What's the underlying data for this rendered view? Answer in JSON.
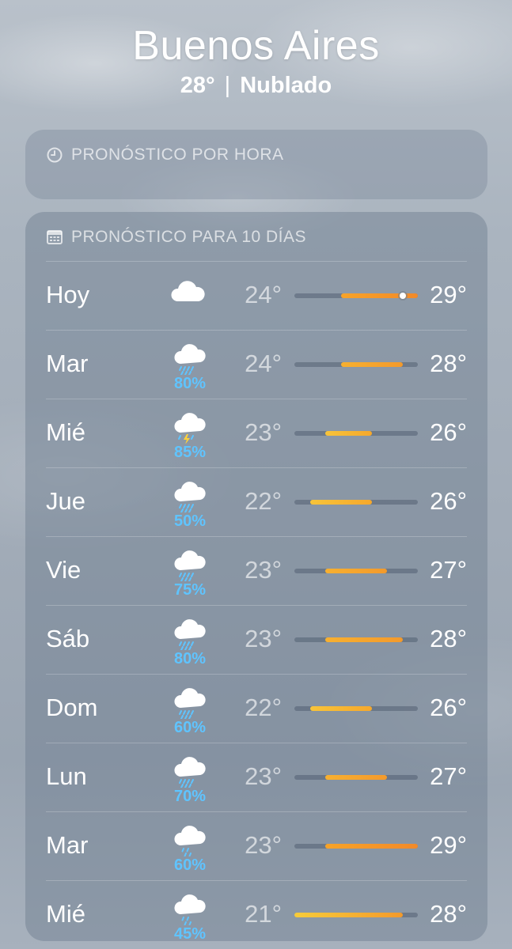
{
  "location": {
    "city": "Buenos Aires",
    "temp": "28°",
    "separator": "|",
    "condition": "Nublado"
  },
  "hourly": {
    "title": "PRONÓSTICO POR HORA",
    "icon": "clock-icon"
  },
  "daily": {
    "title": "PRONÓSTICO PARA 10 DÍAS",
    "icon": "calendar-icon",
    "range": {
      "min": 21,
      "max": 29
    },
    "days": [
      {
        "day": "Hoy",
        "icon": "cloud-icon",
        "precip": "",
        "low": "24°",
        "high": "29°",
        "low_val": 24,
        "high_val": 29,
        "current_val": 28
      },
      {
        "day": "Mar",
        "icon": "cloud-rain-icon",
        "precip": "80%",
        "low": "24°",
        "high": "28°",
        "low_val": 24,
        "high_val": 28
      },
      {
        "day": "Mié",
        "icon": "cloud-bolt-rain-icon",
        "precip": "85%",
        "low": "23°",
        "high": "26°",
        "low_val": 23,
        "high_val": 26
      },
      {
        "day": "Jue",
        "icon": "cloud-rain-icon",
        "precip": "50%",
        "low": "22°",
        "high": "26°",
        "low_val": 22,
        "high_val": 26
      },
      {
        "day": "Vie",
        "icon": "cloud-rain-icon",
        "precip": "75%",
        "low": "23°",
        "high": "27°",
        "low_val": 23,
        "high_val": 27
      },
      {
        "day": "Sáb",
        "icon": "cloud-rain-icon",
        "precip": "80%",
        "low": "23°",
        "high": "28°",
        "low_val": 23,
        "high_val": 28
      },
      {
        "day": "Dom",
        "icon": "cloud-rain-icon",
        "precip": "60%",
        "low": "22°",
        "high": "26°",
        "low_val": 22,
        "high_val": 26
      },
      {
        "day": "Lun",
        "icon": "cloud-rain-icon",
        "precip": "70%",
        "low": "23°",
        "high": "27°",
        "low_val": 23,
        "high_val": 27
      },
      {
        "day": "Mar",
        "icon": "cloud-drizzle-icon",
        "precip": "60%",
        "low": "23°",
        "high": "29°",
        "low_val": 23,
        "high_val": 29
      },
      {
        "day": "Mié",
        "icon": "cloud-drizzle-icon",
        "precip": "45%",
        "low": "21°",
        "high": "28°",
        "low_val": 21,
        "high_val": 28
      }
    ]
  },
  "colors": {
    "precip": "#5fc4ff",
    "bar_warm": "#f7a328",
    "bar_hot": "#f28a2a",
    "bar_mild": "#f7c43a"
  }
}
